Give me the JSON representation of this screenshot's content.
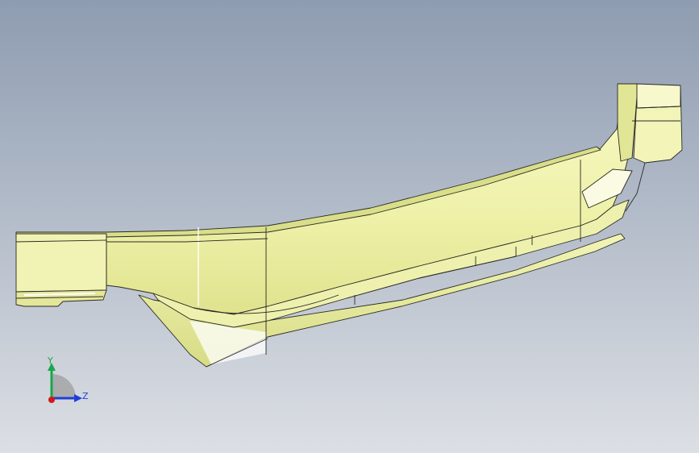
{
  "viewport": {
    "background_top": "#8e9cb1",
    "background_bottom": "#dcdfe4"
  },
  "model": {
    "face_color": "#f4f6b2",
    "face_shade": "#e2e69a",
    "face_dark": "#c9cf7c",
    "edge_color": "#2a2a22",
    "highlight_color": "#ffffff"
  },
  "triad": {
    "y_label": "Y",
    "z_label": "Z",
    "y_color": "#1aa64a",
    "z_color": "#1f3fd6",
    "x_color": "#d11a1a",
    "arc_color": "#9a9a9a"
  }
}
